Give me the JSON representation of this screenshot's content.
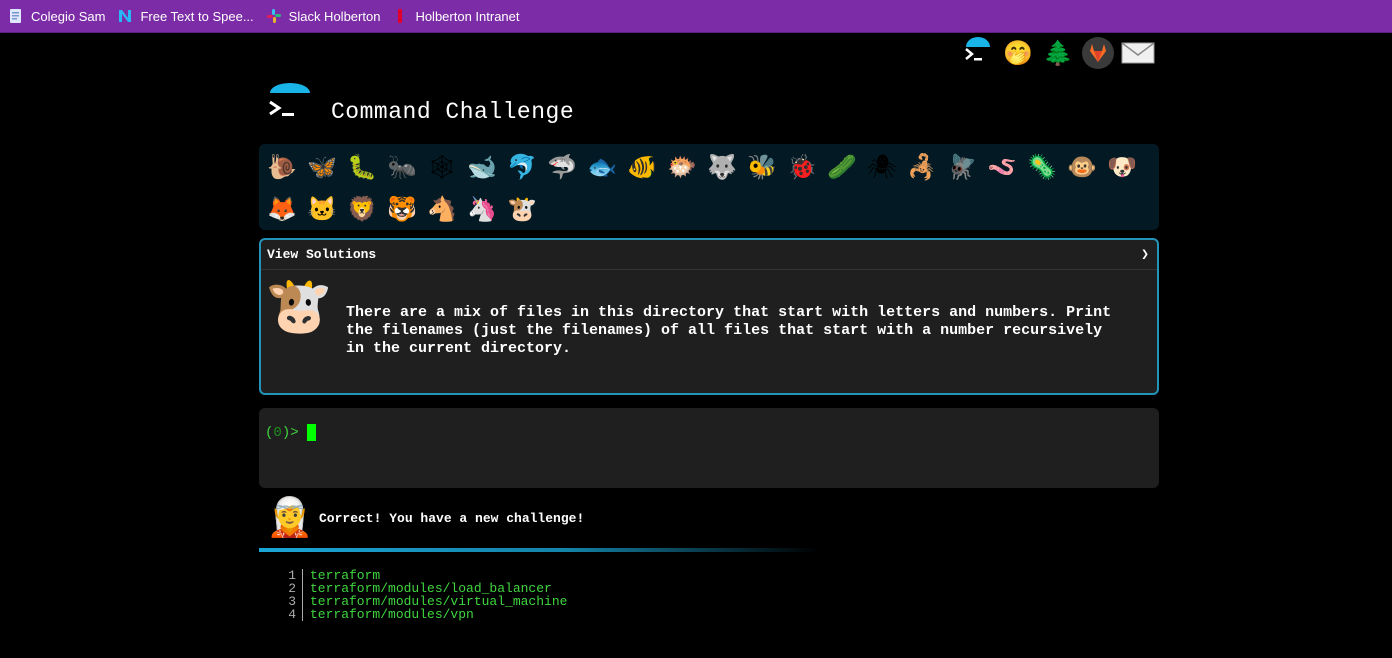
{
  "bookmarks": [
    {
      "label": "Colegio Sam",
      "icon": "document-icon",
      "color": "#dfe8ff"
    },
    {
      "label": "Free Text to Spee...",
      "icon": "n-logo-icon",
      "color": "#29b6f6"
    },
    {
      "label": "Slack Holberton",
      "icon": "slack-icon",
      "color": "#e01e5a"
    },
    {
      "label": "Holberton Intranet",
      "icon": "holberton-icon",
      "color": "#e0002b"
    }
  ],
  "top_icons": [
    {
      "name": "terminal-icon",
      "glyph": "▶"
    },
    {
      "name": "face-hand-icon",
      "glyph": "🤭"
    },
    {
      "name": "tree-icon",
      "glyph": "🌲"
    },
    {
      "name": "gitlab-icon",
      "glyph": "🦊"
    },
    {
      "name": "mail-icon",
      "glyph": "✉"
    }
  ],
  "header": {
    "title": "Command Challenge"
  },
  "animals": [
    {
      "name": "snail",
      "glyph": "🐌"
    },
    {
      "name": "butterfly",
      "glyph": "🦋"
    },
    {
      "name": "caterpillar",
      "glyph": "🐛"
    },
    {
      "name": "ant",
      "glyph": "🐜"
    },
    {
      "name": "spider-web",
      "glyph": "🕸"
    },
    {
      "name": "whale",
      "glyph": "🐋"
    },
    {
      "name": "dolphin",
      "glyph": "🐬"
    },
    {
      "name": "shark",
      "glyph": "🦈"
    },
    {
      "name": "fish",
      "glyph": "🐟"
    },
    {
      "name": "tropical-fish",
      "glyph": "🐠"
    },
    {
      "name": "blowfish",
      "glyph": "🐡"
    },
    {
      "name": "wolf",
      "glyph": "🐺"
    },
    {
      "name": "bee",
      "glyph": "🐝"
    },
    {
      "name": "ladybug",
      "glyph": "🐞"
    },
    {
      "name": "cucumber",
      "glyph": "🥒"
    },
    {
      "name": "spider",
      "glyph": "🕷"
    },
    {
      "name": "scorpion",
      "glyph": "🦂"
    },
    {
      "name": "fly",
      "glyph": "🪰"
    },
    {
      "name": "worm",
      "glyph": "🪱"
    },
    {
      "name": "microbe",
      "glyph": "🦠"
    },
    {
      "name": "monkey",
      "glyph": "🐵"
    },
    {
      "name": "dog",
      "glyph": "🐶"
    },
    {
      "name": "fox",
      "glyph": "🦊"
    },
    {
      "name": "cat",
      "glyph": "🐱"
    },
    {
      "name": "lion",
      "glyph": "🦁"
    },
    {
      "name": "tiger",
      "glyph": "🐯"
    },
    {
      "name": "horse",
      "glyph": "🐴"
    },
    {
      "name": "unicorn",
      "glyph": "🦄"
    },
    {
      "name": "cow",
      "glyph": "🐮"
    }
  ],
  "solutions": {
    "header_label": "View Solutions",
    "chevron": "❯",
    "avatar_glyph": "🐮",
    "challenge_text": "There are a mix of files in this directory that start with letters and numbers. Print the filenames (just the filenames) of all files that start with a number recursively in the current directory."
  },
  "terminal": {
    "prompt_open": "(",
    "prompt_count": "0",
    "prompt_close": ")>"
  },
  "result": {
    "avatar_glyph": "🧝",
    "message": "Correct! You have a new challenge!"
  },
  "output_lines": [
    {
      "n": "1",
      "text": "terraform"
    },
    {
      "n": "2",
      "text": "terraform/modules/load_balancer"
    },
    {
      "n": "3",
      "text": "terraform/modules/virtual_machine"
    },
    {
      "n": "4",
      "text": "terraform/modules/vpn"
    }
  ]
}
